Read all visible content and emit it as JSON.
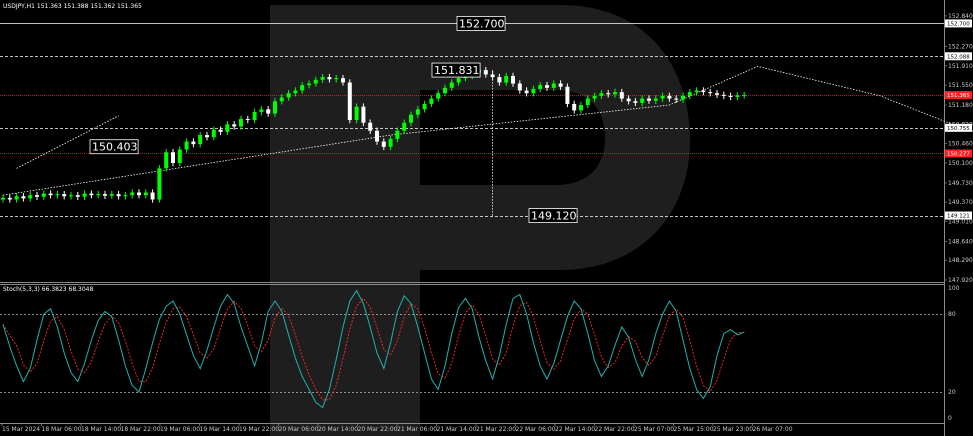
{
  "window": {
    "symbol_header": "USDJPY,H1 151.363 151.388 151.362 151.365",
    "indicator_header": "Stoch(5,3,3) 66.3823 68.3048"
  },
  "colors": {
    "background": "#000000",
    "bull_candle": "#00ff00",
    "bear_candle": "#ffffff",
    "stoch_main": "#20b2aa",
    "stoch_signal": "#ff2a2a",
    "current_price_tag": "#ff2020",
    "watermark": "#1e1e1e"
  },
  "chart_data": [
    {
      "type": "candlestick",
      "symbol": "USDJPY",
      "timeframe": "H1",
      "x_ticks": [
        "15 Mar 2024",
        "18 Mar 06:00",
        "18 Mar 14:00",
        "18 Mar 22:00",
        "19 Mar 06:00",
        "19 Mar 14:00",
        "19 Mar 22:00",
        "20 Mar 06:00",
        "20 Mar 14:00",
        "20 Mar 22:00",
        "21 Mar 06:00",
        "21 Mar 14:00",
        "21 Mar 22:00",
        "22 Mar 06:00",
        "22 Mar 14:00",
        "22 Mar 22:00",
        "25 Mar 07:00",
        "25 Mar 15:00",
        "25 Mar 23:00",
        "26 Mar 07:00"
      ],
      "y_ticks": [
        "152.840",
        "152.270",
        "151.910",
        "151.550",
        "151.180",
        "150.820",
        "150.460",
        "150.100",
        "149.730",
        "149.370",
        "149.010",
        "148.640",
        "148.290",
        "147.920"
      ],
      "ylim": [
        147.92,
        152.95
      ],
      "price_tags": [
        {
          "label": "152.700",
          "value": 152.7,
          "color": "#ffffff"
        },
        {
          "label": "152.088",
          "value": 152.088,
          "color": "#ffffff"
        },
        {
          "label": "151.365",
          "value": 151.365,
          "color": "#ff2020"
        },
        {
          "label": "150.755",
          "value": 150.755,
          "color": "#ffffff"
        },
        {
          "label": "150.277",
          "value": 150.277,
          "color": "#ff2020"
        },
        {
          "label": "149.121",
          "value": 149.121,
          "color": "#ffffff"
        }
      ],
      "annotations": [
        {
          "text": "152.700",
          "value": 152.7
        },
        {
          "text": "151.831",
          "value": 151.831
        },
        {
          "text": "150.403",
          "value": 150.403
        },
        {
          "text": "149.120",
          "value": 149.12
        }
      ],
      "levels": [
        {
          "value": 152.7,
          "style": "solid",
          "color": "#ffffff"
        },
        {
          "value": 152.088,
          "style": "dashed",
          "color": "#ffffff"
        },
        {
          "value": 151.365,
          "style": "dotted",
          "color": "#ff2020"
        },
        {
          "value": 150.755,
          "style": "dashed",
          "color": "#ffffff"
        },
        {
          "value": 150.277,
          "style": "dotted",
          "color": "#ff2020"
        },
        {
          "value": 149.121,
          "style": "dashed",
          "color": "#ffffff"
        }
      ],
      "close": [
        149.45,
        149.42,
        149.48,
        149.44,
        149.5,
        149.47,
        149.53,
        149.5,
        149.52,
        149.48,
        149.5,
        149.47,
        149.53,
        149.5,
        149.52,
        149.49,
        149.52,
        149.48,
        149.5,
        149.55,
        149.5,
        149.55,
        149.42,
        150.0,
        150.3,
        150.1,
        150.35,
        150.5,
        150.45,
        150.62,
        150.58,
        150.72,
        150.68,
        150.82,
        150.78,
        150.92,
        150.9,
        151.05,
        151.1,
        151.02,
        151.25,
        151.32,
        151.4,
        151.45,
        151.55,
        151.58,
        151.65,
        151.7,
        151.66,
        151.68,
        151.6,
        150.9,
        151.15,
        150.85,
        150.7,
        150.5,
        150.4,
        150.55,
        150.7,
        150.85,
        151.0,
        151.1,
        151.2,
        151.3,
        151.4,
        151.5,
        151.6,
        151.68,
        151.72,
        151.78,
        151.83,
        151.75,
        151.7,
        151.6,
        151.72,
        151.58,
        151.45,
        151.4,
        151.48,
        151.55,
        151.5,
        151.58,
        151.52,
        151.2,
        151.08,
        151.18,
        151.3,
        151.35,
        151.4,
        151.38,
        151.42,
        151.3,
        151.25,
        151.22,
        151.3,
        151.26,
        151.3,
        151.35,
        151.3,
        151.28,
        151.35,
        151.42,
        151.45,
        151.42,
        151.4,
        151.37,
        151.35,
        151.33,
        151.36,
        151.365
      ],
      "overlay_path": [
        [
          149.5,
          150.45
        ],
        [
          150.0,
          151.18
        ],
        [
          150.3,
          151.9
        ],
        [
          150.75,
          152.1
        ],
        [
          151.05,
          151.65
        ],
        [
          151.2,
          151.38
        ],
        [
          151.25,
          150.0
        ],
        [
          151.0,
          149.12
        ]
      ]
    },
    {
      "type": "line",
      "title": "Stoch(5,3,3) 66.3823 68.3048",
      "ylim": [
        0,
        100
      ],
      "y_ticks": [
        "100",
        "80",
        "20",
        "0"
      ],
      "levels": [
        80,
        20
      ],
      "series": [
        {
          "name": "Main",
          "values": [
            72,
            55,
            40,
            28,
            38,
            60,
            80,
            84,
            70,
            50,
            35,
            28,
            42,
            60,
            75,
            82,
            78,
            60,
            40,
            25,
            20,
            38,
            58,
            76,
            86,
            90,
            80,
            64,
            48,
            38,
            52,
            70,
            86,
            95,
            88,
            70,
            55,
            40,
            58,
            82,
            90,
            82,
            64,
            46,
            32,
            22,
            12,
            8,
            22,
            45,
            70,
            90,
            98,
            88,
            70,
            50,
            38,
            58,
            82,
            94,
            88,
            70,
            50,
            30,
            22,
            40,
            65,
            85,
            92,
            84,
            62,
            44,
            30,
            48,
            72,
            92,
            95,
            80,
            58,
            40,
            30,
            42,
            60,
            78,
            90,
            84,
            65,
            44,
            32,
            40,
            56,
            70,
            62,
            45,
            32,
            45,
            65,
            80,
            90,
            82,
            60,
            38,
            22,
            15,
            24,
            48,
            65,
            68,
            64,
            66
          ]
        }
      ]
    }
  ]
}
